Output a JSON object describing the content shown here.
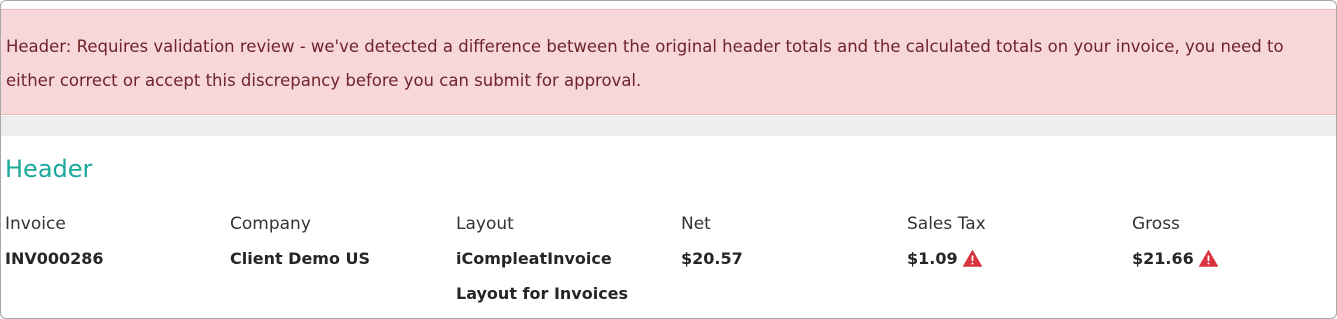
{
  "alert": {
    "message": "Header: Requires validation review -  we've detected a difference between the original header totals and the calculated totals on your invoice, you need to either correct or accept this discrepancy before you can submit for approval.",
    "color": "#f8d7da"
  },
  "header": {
    "title": "Header",
    "title_color": "#1aa89a",
    "fields": {
      "invoice": {
        "label": "Invoice",
        "value": "INV000286"
      },
      "company": {
        "label": "Company",
        "value": "Client Demo US"
      },
      "layout": {
        "label": "Layout",
        "value": "iCompleatInvoice",
        "value2": "Layout for Invoices"
      },
      "net": {
        "label": "Net",
        "value": "$20.57"
      },
      "sales_tax": {
        "label": "Sales Tax",
        "value": "$1.09",
        "icon": "warning-icon"
      },
      "gross": {
        "label": "Gross",
        "value": "$21.66",
        "icon": "warning-icon"
      }
    },
    "warning_color": "#d9333f"
  }
}
